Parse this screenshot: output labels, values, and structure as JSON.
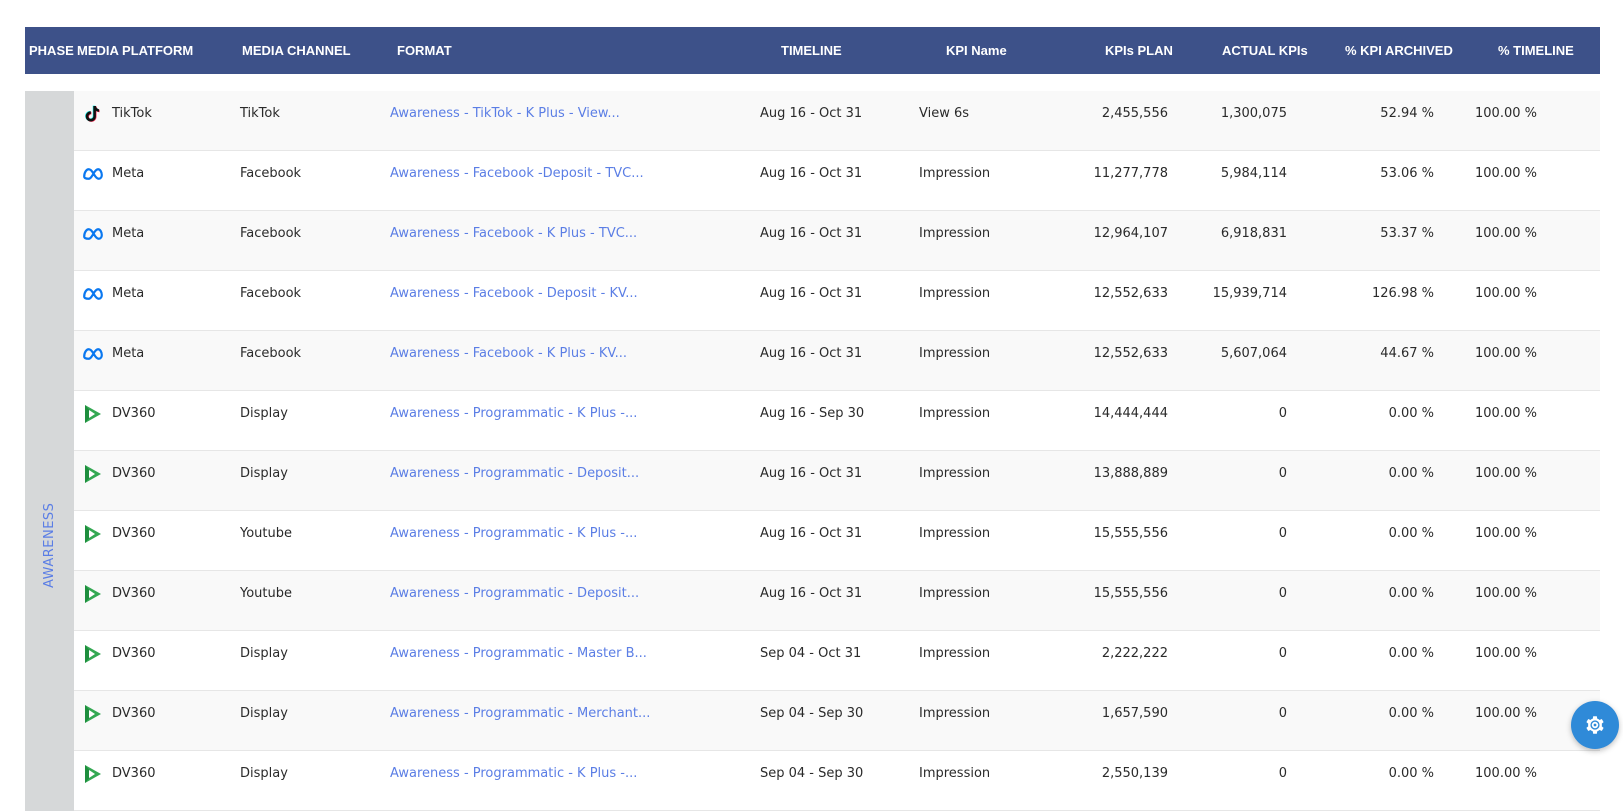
{
  "header": {
    "columns": [
      "PHASE",
      "MEDIA PLATFORM",
      "MEDIA CHANNEL",
      "FORMAT",
      "TIMELINE",
      "KPI Name",
      "KPIs PLAN",
      "ACTUAL KPIs",
      "% KPI ARCHIVED",
      "% TIMELINE"
    ]
  },
  "phase": "AWARENESS",
  "rows": [
    {
      "platform": "TikTok",
      "icon": "tiktok-icon",
      "channel": "TikTok",
      "format": "Awareness - TikTok - K Plus - View...",
      "timeline": "Aug 16 - Oct 31",
      "kpi": "View 6s",
      "plan": "2,455,556",
      "actual": "1,300,075",
      "kpi_pct": "52.94 %",
      "time_pct": "100.00 %"
    },
    {
      "platform": "Meta",
      "icon": "meta-icon",
      "channel": "Facebook",
      "format": "Awareness - Facebook -Deposit - TVC...",
      "timeline": "Aug 16 - Oct 31",
      "kpi": "Impression",
      "plan": "11,277,778",
      "actual": "5,984,114",
      "kpi_pct": "53.06 %",
      "time_pct": "100.00 %"
    },
    {
      "platform": "Meta",
      "icon": "meta-icon",
      "channel": "Facebook",
      "format": "Awareness - Facebook - K Plus - TVC...",
      "timeline": "Aug 16 - Oct 31",
      "kpi": "Impression",
      "plan": "12,964,107",
      "actual": "6,918,831",
      "kpi_pct": "53.37 %",
      "time_pct": "100.00 %"
    },
    {
      "platform": "Meta",
      "icon": "meta-icon",
      "channel": "Facebook",
      "format": "Awareness - Facebook - Deposit - KV...",
      "timeline": "Aug 16 - Oct 31",
      "kpi": "Impression",
      "plan": "12,552,633",
      "actual": "15,939,714",
      "kpi_pct": "126.98 %",
      "time_pct": "100.00 %"
    },
    {
      "platform": "Meta",
      "icon": "meta-icon",
      "channel": "Facebook",
      "format": "Awareness - Facebook - K Plus - KV...",
      "timeline": "Aug 16 - Oct 31",
      "kpi": "Impression",
      "plan": "12,552,633",
      "actual": "5,607,064",
      "kpi_pct": "44.67 %",
      "time_pct": "100.00 %"
    },
    {
      "platform": "DV360",
      "icon": "dv360-icon",
      "channel": "Display",
      "format": "Awareness - Programmatic - K Plus -...",
      "timeline": "Aug 16 - Sep 30",
      "kpi": "Impression",
      "plan": "14,444,444",
      "actual": "0",
      "kpi_pct": "0.00 %",
      "time_pct": "100.00 %"
    },
    {
      "platform": "DV360",
      "icon": "dv360-icon",
      "channel": "Display",
      "format": "Awareness - Programmatic - Deposit...",
      "timeline": "Aug 16 - Oct 31",
      "kpi": "Impression",
      "plan": "13,888,889",
      "actual": "0",
      "kpi_pct": "0.00 %",
      "time_pct": "100.00 %"
    },
    {
      "platform": "DV360",
      "icon": "dv360-icon",
      "channel": "Youtube",
      "format": "Awareness - Programmatic - K Plus -...",
      "timeline": "Aug 16 - Oct 31",
      "kpi": "Impression",
      "plan": "15,555,556",
      "actual": "0",
      "kpi_pct": "0.00 %",
      "time_pct": "100.00 %"
    },
    {
      "platform": "DV360",
      "icon": "dv360-icon",
      "channel": "Youtube",
      "format": "Awareness - Programmatic - Deposit...",
      "timeline": "Aug 16 - Oct 31",
      "kpi": "Impression",
      "plan": "15,555,556",
      "actual": "0",
      "kpi_pct": "0.00 %",
      "time_pct": "100.00 %"
    },
    {
      "platform": "DV360",
      "icon": "dv360-icon",
      "channel": "Display",
      "format": "Awareness - Programmatic - Master B...",
      "timeline": "Sep 04 - Oct 31",
      "kpi": "Impression",
      "plan": "2,222,222",
      "actual": "0",
      "kpi_pct": "0.00 %",
      "time_pct": "100.00 %"
    },
    {
      "platform": "DV360",
      "icon": "dv360-icon",
      "channel": "Display",
      "format": "Awareness - Programmatic - Merchant...",
      "timeline": "Sep 04 - Sep 30",
      "kpi": "Impression",
      "plan": "1,657,590",
      "actual": "0",
      "kpi_pct": "0.00 %",
      "time_pct": "100.00 %"
    },
    {
      "platform": "DV360",
      "icon": "dv360-icon",
      "channel": "Display",
      "format": "Awareness - Programmatic - K Plus -...",
      "timeline": "Sep 04 - Sep 30",
      "kpi": "Impression",
      "plan": "2,550,139",
      "actual": "0",
      "kpi_pct": "0.00 %",
      "time_pct": "100.00 %"
    }
  ],
  "fab": {
    "icon": "gear-icon"
  },
  "colors": {
    "header_bg": "#3d5189",
    "link": "#5b7ee5",
    "phase_bg": "#d6d8d9",
    "fab": "#2f8ad8"
  }
}
